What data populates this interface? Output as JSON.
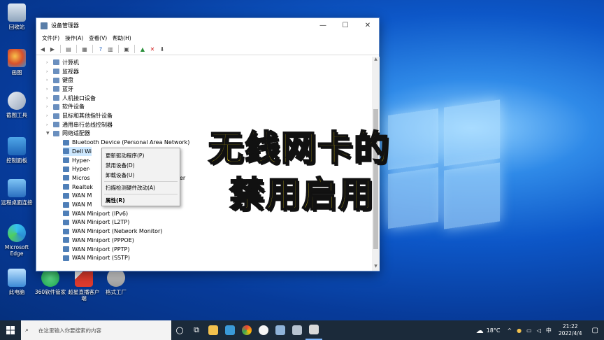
{
  "desktop": {
    "icons": [
      {
        "label": "回收站"
      },
      {
        "label": "画图"
      },
      {
        "label": "截图工具"
      },
      {
        "label": "控制面板"
      },
      {
        "label": "远程桌面连接"
      },
      {
        "label": "Microsoft Edge"
      },
      {
        "label": "此电脑"
      },
      {
        "label": "360软件管家"
      },
      {
        "label": "超星直播客户端"
      },
      {
        "label": "格式工厂"
      }
    ]
  },
  "window": {
    "title": "设备管理器",
    "menu": [
      "文件(F)",
      "操作(A)",
      "查看(V)",
      "帮助(H)"
    ],
    "controls": {
      "minimize": "—",
      "maximize": "☐",
      "close": "✕"
    },
    "tree": [
      {
        "label": "计算机",
        "level": 0
      },
      {
        "label": "监视器",
        "level": 0
      },
      {
        "label": "键盘",
        "level": 0
      },
      {
        "label": "蓝牙",
        "level": 0
      },
      {
        "label": "人机接口设备",
        "level": 0
      },
      {
        "label": "软件设备",
        "level": 0
      },
      {
        "label": "鼠标和其他指针设备",
        "level": 0
      },
      {
        "label": "通用串行总线控制器",
        "level": 0
      },
      {
        "label": "网络适配器",
        "level": 0,
        "expanded": true
      },
      {
        "label": "Bluetooth Device (Personal Area Network)",
        "level": 1
      },
      {
        "label": "Dell Wi",
        "level": 1,
        "selected": true
      },
      {
        "label": "Hyper-",
        "level": 1
      },
      {
        "label": "Hyper-",
        "level": 1
      },
      {
        "label": "Micros",
        "level": 1,
        "suffix": "river"
      },
      {
        "label": "Realtek",
        "level": 1
      },
      {
        "label": "WAN M",
        "level": 1
      },
      {
        "label": "WAN M",
        "level": 1
      },
      {
        "label": "WAN Miniport (IPv6)",
        "level": 1
      },
      {
        "label": "WAN Miniport (L2TP)",
        "level": 1
      },
      {
        "label": "WAN Miniport (Network Monitor)",
        "level": 1
      },
      {
        "label": "WAN Miniport (PPPOE)",
        "level": 1
      },
      {
        "label": "WAN Miniport (PPTP)",
        "level": 1
      },
      {
        "label": "WAN Miniport (SSTP)",
        "level": 1
      }
    ]
  },
  "context_menu": {
    "items": [
      "更新驱动程序(P)",
      "禁用设备(D)",
      "卸载设备(U)",
      "扫描检测硬件改动(A)",
      "属性(R)"
    ]
  },
  "overlay": {
    "line1": "无线网卡的",
    "line2": "禁用启用"
  },
  "taskbar": {
    "search_placeholder": "在这里输入你要搜索的内容",
    "temperature": "18°C",
    "ime": "中",
    "time": "21:22",
    "date": "2022/4/4"
  }
}
